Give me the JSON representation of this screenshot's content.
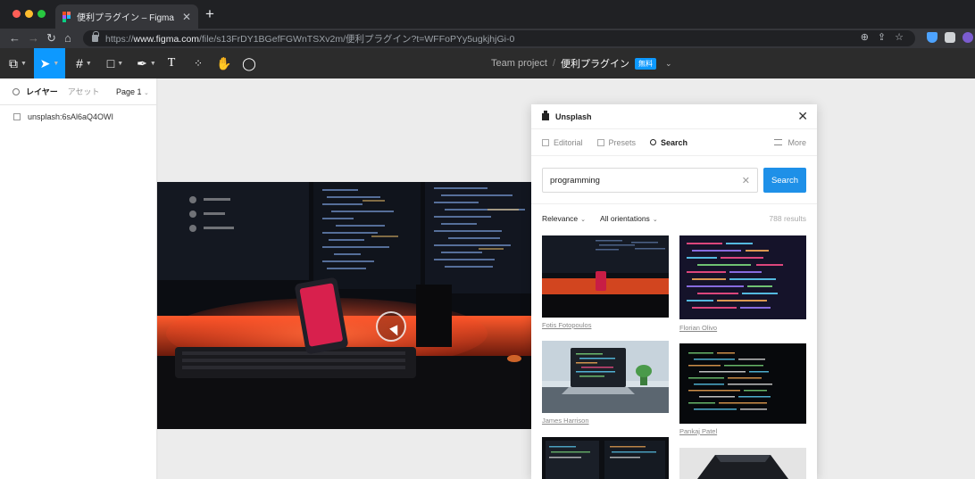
{
  "browser": {
    "tab_title": "便利プラグイン – Figma",
    "tab_close": "✕",
    "new_tab": "+",
    "url_scheme": "https://",
    "url_host": "www.figma.com",
    "url_path": "/file/s13FrDY1BGefFGWnTSXv2m/便利プラグイン?t=WFFoPYy5ugkjhjGi-0"
  },
  "figma_toolbar": {
    "team": "Team project",
    "separator": "/",
    "file_name": "便利プラグイン",
    "badge": "無料"
  },
  "layers_panel": {
    "tab_layers": "レイヤー",
    "tab_assets": "アセット",
    "page": "Page 1",
    "layers": [
      "unsplash:6sAl6aQ4OWI"
    ]
  },
  "plugin": {
    "name": "Unsplash",
    "nav": {
      "editorial": "Editorial",
      "presets": "Presets",
      "search": "Search",
      "more": "More"
    },
    "search_value": "programming",
    "search_button": "Search",
    "sort": "Relevance",
    "orientation": "All orientations",
    "results": "788 results",
    "credits": [
      "Fotis Fotopoulos",
      "Florian Olivo",
      "James Harrison",
      "Pankaj Patel"
    ]
  }
}
